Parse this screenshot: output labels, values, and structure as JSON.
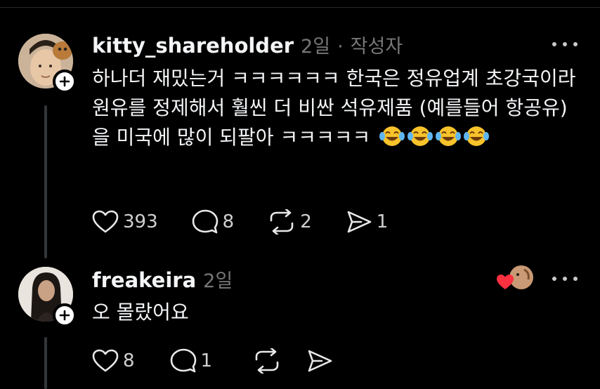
{
  "posts": [
    {
      "username": "kitty_shareholder",
      "time": "2일",
      "separator": "·",
      "author_tag": "작성자",
      "text": "하나더 재밌는거 ㅋㅋㅋㅋㅋㅋ 한국은 정유업계 초강국이라 원유를 정제해서 훨씬 더 비싼 석유제품 (예를들어 항공유)을 미국에 많이 되팔아 ㅋㅋㅋㅋㅋ",
      "emoji_count": 4,
      "likes": "393",
      "comments": "8",
      "reposts": "2",
      "shares": "1"
    },
    {
      "username": "freakeira",
      "time": "2일",
      "text": "오 몰랐어요",
      "likes": "8",
      "comments": "1",
      "reposts": "",
      "shares": ""
    }
  ],
  "icons": {
    "like": "heart-outline-icon",
    "comment": "speech-bubble-icon",
    "repost": "repost-arrows-icon",
    "share": "send-icon",
    "more": "more-dots-icon",
    "follow": "plus-icon",
    "emoji": "face-with-tears-of-joy",
    "liked_by": "red-heart-icon"
  },
  "colors": {
    "background": "#000000",
    "text": "#f3f5f7",
    "muted": "#777777",
    "heart_red": "#ff3040",
    "emoji_yellow": "#f8c32b"
  }
}
